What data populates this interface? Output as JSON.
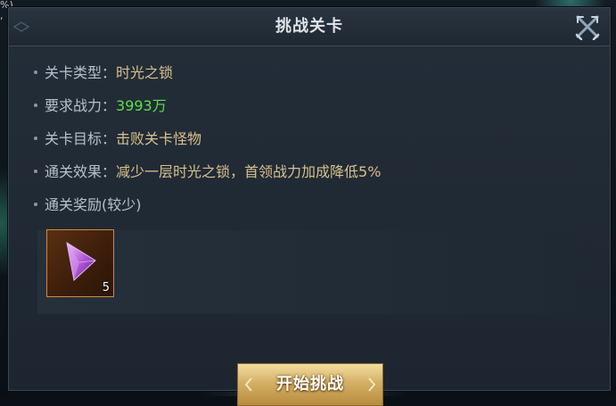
{
  "background": {
    "fragment_line1": "%)",
    "fragment_line2": ","
  },
  "dialog": {
    "title": "挑战关卡",
    "rows": [
      {
        "label": "关卡类型：",
        "value": "时光之锁"
      },
      {
        "label": "要求战力：",
        "value": "3993万"
      },
      {
        "label": "关卡目标：",
        "value": "击败关卡怪物"
      },
      {
        "label": "通关效果：",
        "value": "减少一层时光之锁，首领战力加成降低5%"
      },
      {
        "label": "通关奖励(较少)",
        "value": ""
      }
    ],
    "reward": {
      "icon": "purple-crystal-shard-icon",
      "count": "5"
    },
    "start_button": "开始挑战",
    "colors": {
      "value_gold": "#d8c08b",
      "value_green": "#5be04a",
      "label_grey": "#b7c1cc",
      "button_gold": "#d4b066"
    }
  }
}
